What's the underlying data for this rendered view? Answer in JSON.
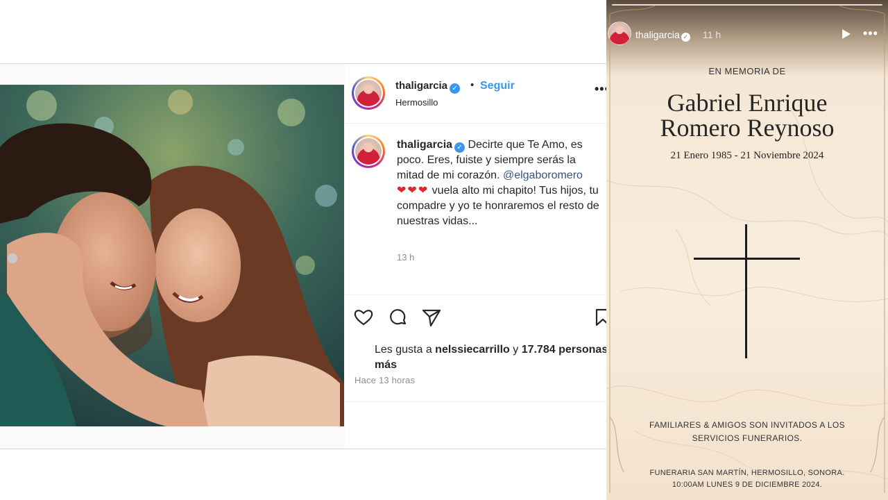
{
  "post": {
    "username": "thaligarcia",
    "verified_mark": "✓",
    "separator": "•",
    "follow_label": "Seguir",
    "location": "Hermosillo",
    "more_label": "•••",
    "caption": {
      "username": "thaligarcia",
      "text_part1": " Decirte que Te Amo, es poco. Eres, fuiste y siempre serás la mitad de mi corazón. ",
      "mention": "@elgaboromero",
      "hearts": "❤❤❤",
      "text_part2": " vuela alto mi chapito! Tus hijos, tu compadre y yo te honraremos el resto de nuestras vidas...",
      "time": "13 h"
    },
    "likes": {
      "prefix": "Les gusta a ",
      "user": "nelssiecarrillo",
      "middle": " y ",
      "count": "17.784 personas",
      "suffix": "más"
    },
    "posted_ago": "Hace 13 horas",
    "icons": [
      "heart-icon",
      "comment-icon",
      "share-icon",
      "bookmark-icon"
    ],
    "colors": {
      "link": "#3897f0",
      "heart": "#e0262b",
      "muted": "#8e8e8e"
    }
  },
  "story": {
    "username": "thaligarcia",
    "verified_mark": "✓",
    "time": "11 h",
    "more_label": "•••",
    "title": "EN MEMORIA DE",
    "name_line1": "Gabriel Enrique",
    "name_line2": "Romero Reynoso",
    "dates": "21 Enero 1985 - 21 Noviembre 2024",
    "invite_line1": "FAMILIARES & AMIGOS SON INVITADOS A LOS",
    "invite_line2": "SERVICIOS FUNERARIOS.",
    "funeral_line1": "FUNERARIA SAN MARTÍN, HERMOSILLO, SONORA.",
    "funeral_line2": "10:00AM LUNES 9 DE DICIEMBRE 2024."
  }
}
